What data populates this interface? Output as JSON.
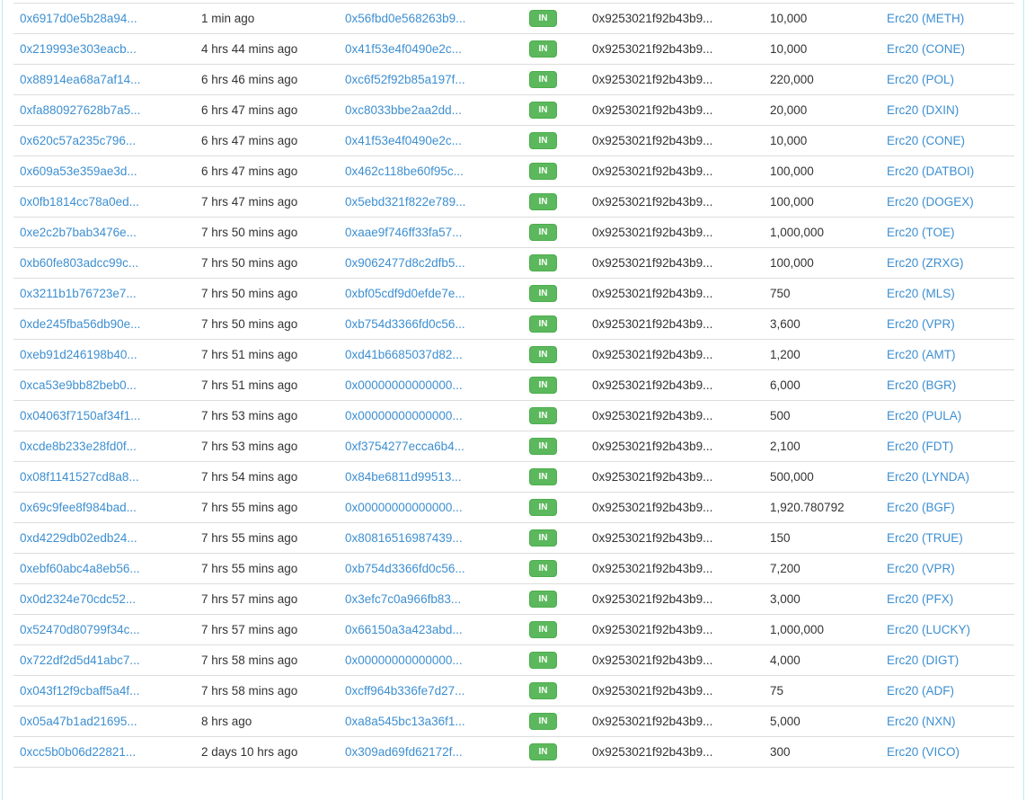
{
  "colors": {
    "link_blue": "#3d8fd1",
    "badge_green": "#5cb85c",
    "badge_border_green": "#4cae4c",
    "row_divider": "#dddddd",
    "panel_border": "#bce8f1",
    "text": "#333333"
  },
  "table": {
    "rows": [
      {
        "tx_hash": "0x6917d0e5b28a94...",
        "age": "1 min ago",
        "from": "0x56fbd0e568263b9...",
        "direction": "IN",
        "to": "0x9253021f92b43b9...",
        "value": "10,000",
        "token": "Erc20 (METH)"
      },
      {
        "tx_hash": "0x219993e303eacb...",
        "age": "4 hrs 44 mins ago",
        "from": "0x41f53e4f0490e2c...",
        "direction": "IN",
        "to": "0x9253021f92b43b9...",
        "value": "10,000",
        "token": "Erc20 (CONE)"
      },
      {
        "tx_hash": "0x88914ea68a7af14...",
        "age": "6 hrs 46 mins ago",
        "from": "0xc6f52f92b85a197f...",
        "direction": "IN",
        "to": "0x9253021f92b43b9...",
        "value": "220,000",
        "token": "Erc20 (POL)"
      },
      {
        "tx_hash": "0xfa880927628b7a5...",
        "age": "6 hrs 47 mins ago",
        "from": "0xc8033bbe2aa2dd...",
        "direction": "IN",
        "to": "0x9253021f92b43b9...",
        "value": "20,000",
        "token": "Erc20 (DXIN)"
      },
      {
        "tx_hash": "0x620c57a235c796...",
        "age": "6 hrs 47 mins ago",
        "from": "0x41f53e4f0490e2c...",
        "direction": "IN",
        "to": "0x9253021f92b43b9...",
        "value": "10,000",
        "token": "Erc20 (CONE)"
      },
      {
        "tx_hash": "0x609a53e359ae3d...",
        "age": "6 hrs 47 mins ago",
        "from": "0x462c118be60f95c...",
        "direction": "IN",
        "to": "0x9253021f92b43b9...",
        "value": "100,000",
        "token": "Erc20 (DATBOI)"
      },
      {
        "tx_hash": "0x0fb1814cc78a0ed...",
        "age": "7 hrs 47 mins ago",
        "from": "0x5ebd321f822e789...",
        "direction": "IN",
        "to": "0x9253021f92b43b9...",
        "value": "100,000",
        "token": "Erc20 (DOGEX)"
      },
      {
        "tx_hash": "0xe2c2b7bab3476e...",
        "age": "7 hrs 50 mins ago",
        "from": "0xaae9f746ff33fa57...",
        "direction": "IN",
        "to": "0x9253021f92b43b9...",
        "value": "1,000,000",
        "token": "Erc20 (TOE)"
      },
      {
        "tx_hash": "0xb60fe803adcc99c...",
        "age": "7 hrs 50 mins ago",
        "from": "0x9062477d8c2dfb5...",
        "direction": "IN",
        "to": "0x9253021f92b43b9...",
        "value": "100,000",
        "token": "Erc20 (ZRXG)"
      },
      {
        "tx_hash": "0x3211b1b76723e7...",
        "age": "7 hrs 50 mins ago",
        "from": "0xbf05cdf9d0efde7e...",
        "direction": "IN",
        "to": "0x9253021f92b43b9...",
        "value": "750",
        "token": "Erc20 (MLS)"
      },
      {
        "tx_hash": "0xde245fba56db90e...",
        "age": "7 hrs 50 mins ago",
        "from": "0xb754d3366fd0c56...",
        "direction": "IN",
        "to": "0x9253021f92b43b9...",
        "value": "3,600",
        "token": "Erc20 (VPR)"
      },
      {
        "tx_hash": "0xeb91d246198b40...",
        "age": "7 hrs 51 mins ago",
        "from": "0xd41b6685037d82...",
        "direction": "IN",
        "to": "0x9253021f92b43b9...",
        "value": "1,200",
        "token": "Erc20 (AMT)"
      },
      {
        "tx_hash": "0xca53e9bb82beb0...",
        "age": "7 hrs 51 mins ago",
        "from": "0x00000000000000...",
        "direction": "IN",
        "to": "0x9253021f92b43b9...",
        "value": "6,000",
        "token": "Erc20 (BGR)"
      },
      {
        "tx_hash": "0x04063f7150af34f1...",
        "age": "7 hrs 53 mins ago",
        "from": "0x00000000000000...",
        "direction": "IN",
        "to": "0x9253021f92b43b9...",
        "value": "500",
        "token": "Erc20 (PULA)"
      },
      {
        "tx_hash": "0xcde8b233e28fd0f...",
        "age": "7 hrs 53 mins ago",
        "from": "0xf3754277ecca6b4...",
        "direction": "IN",
        "to": "0x9253021f92b43b9...",
        "value": "2,100",
        "token": "Erc20 (FDT)"
      },
      {
        "tx_hash": "0x08f1141527cd8a8...",
        "age": "7 hrs 54 mins ago",
        "from": "0x84be6811d99513...",
        "direction": "IN",
        "to": "0x9253021f92b43b9...",
        "value": "500,000",
        "token": "Erc20 (LYNDA)"
      },
      {
        "tx_hash": "0x69c9fee8f984bad...",
        "age": "7 hrs 55 mins ago",
        "from": "0x00000000000000...",
        "direction": "IN",
        "to": "0x9253021f92b43b9...",
        "value": "1,920.780792",
        "token": "Erc20 (BGF)"
      },
      {
        "tx_hash": "0xd4229db02edb24...",
        "age": "7 hrs 55 mins ago",
        "from": "0x80816516987439...",
        "direction": "IN",
        "to": "0x9253021f92b43b9...",
        "value": "150",
        "token": "Erc20 (TRUE)"
      },
      {
        "tx_hash": "0xebf60abc4a8eb56...",
        "age": "7 hrs 55 mins ago",
        "from": "0xb754d3366fd0c56...",
        "direction": "IN",
        "to": "0x9253021f92b43b9...",
        "value": "7,200",
        "token": "Erc20 (VPR)"
      },
      {
        "tx_hash": "0x0d2324e70cdc52...",
        "age": "7 hrs 57 mins ago",
        "from": "0x3efc7c0a966fb83...",
        "direction": "IN",
        "to": "0x9253021f92b43b9...",
        "value": "3,000",
        "token": "Erc20 (PFX)"
      },
      {
        "tx_hash": "0x52470d80799f34c...",
        "age": "7 hrs 57 mins ago",
        "from": "0x66150a3a423abd...",
        "direction": "IN",
        "to": "0x9253021f92b43b9...",
        "value": "1,000,000",
        "token": "Erc20 (LUCKY)"
      },
      {
        "tx_hash": "0x722df2d5d41abc7...",
        "age": "7 hrs 58 mins ago",
        "from": "0x00000000000000...",
        "direction": "IN",
        "to": "0x9253021f92b43b9...",
        "value": "4,000",
        "token": "Erc20 (DIGT)"
      },
      {
        "tx_hash": "0x043f12f9cbaff5a4f...",
        "age": "7 hrs 58 mins ago",
        "from": "0xcff964b336fe7d27...",
        "direction": "IN",
        "to": "0x9253021f92b43b9...",
        "value": "75",
        "token": "Erc20 (ADF)"
      },
      {
        "tx_hash": "0x05a47b1ad21695...",
        "age": "8 hrs ago",
        "from": "0xa8a545bc13a36f1...",
        "direction": "IN",
        "to": "0x9253021f92b43b9...",
        "value": "5,000",
        "token": "Erc20 (NXN)"
      },
      {
        "tx_hash": "0xcc5b0b06d22821...",
        "age": "2 days 10 hrs ago",
        "from": "0x309ad69fd62172f...",
        "direction": "IN",
        "to": "0x9253021f92b43b9...",
        "value": "300",
        "token": "Erc20 (VICO)"
      }
    ]
  }
}
